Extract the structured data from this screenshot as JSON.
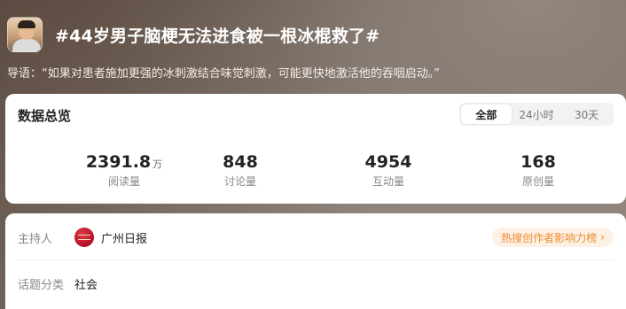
{
  "topic": {
    "title": "#44岁男子脑梗无法进食被一根冰棍救了#",
    "lead_prefix": "导语：",
    "lead_text": "“如果对患者施加更强的冰刺激结合味觉刺激，可能更快地激活他的吞咽启动。”"
  },
  "overview": {
    "title": "数据总览",
    "tabs": [
      {
        "label": "全部",
        "active": true
      },
      {
        "label": "24小时",
        "active": false
      },
      {
        "label": "30天",
        "active": false
      }
    ],
    "stats": [
      {
        "value": "2391.8",
        "unit": "万",
        "label": "阅读量"
      },
      {
        "value": "848",
        "unit": "",
        "label": "讨论量"
      },
      {
        "value": "4954",
        "unit": "",
        "label": "互动量"
      },
      {
        "value": "168",
        "unit": "",
        "label": "原创量"
      }
    ]
  },
  "info": {
    "host_label": "主持人",
    "host_name": "广州日报",
    "influence_link": "热搜创作者影响力榜",
    "category_label": "话题分类",
    "category_value": "社会"
  },
  "colors": {
    "accent_orange": "#f08a2c",
    "pill_bg": "#fdf1e6",
    "host_logo": "#c41228"
  }
}
